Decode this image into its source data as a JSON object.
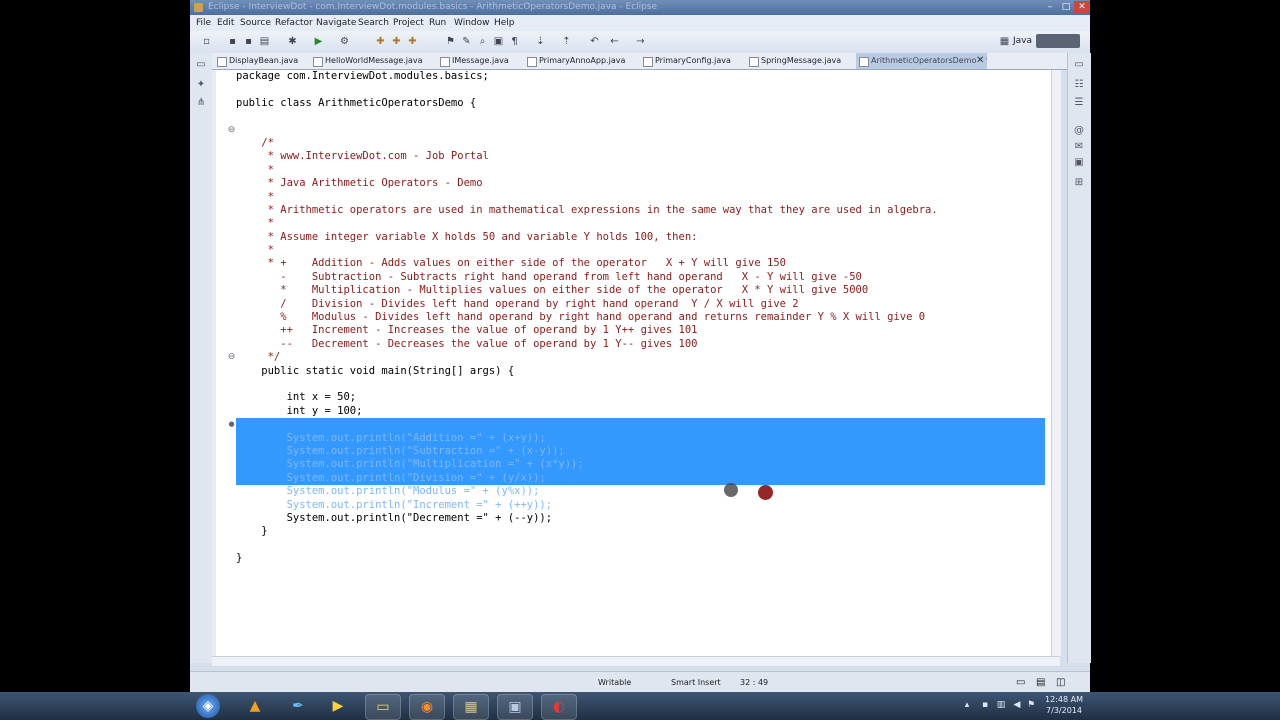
{
  "window": {
    "title": "Eclipse - InterviewDot - com.InterviewDot.modules.basics - ArithmeticOperatorsDemo.java - Eclipse",
    "minimize": "–",
    "maximize": "□",
    "close": "✕"
  },
  "menu": [
    "File",
    "Edit",
    "Source",
    "Refactor",
    "Navigate",
    "Search",
    "Project",
    "Run",
    "Window",
    "Help"
  ],
  "perspective": {
    "label": "Java"
  },
  "tabs": [
    {
      "label": "DisplayBean.java"
    },
    {
      "label": "HelloWorldMessage.java"
    },
    {
      "label": "IMessage.java"
    },
    {
      "label": "PrimaryAnnoApp.java"
    },
    {
      "label": "PrimaryConfig.java"
    },
    {
      "label": "SpringMessage.java"
    },
    {
      "label": "ArithmeticOperatorsDemo.java",
      "active": true,
      "close": "✕"
    }
  ],
  "code": {
    "lines": [
      "package com.InterviewDot.modules.basics;",
      "",
      "public class ArithmeticOperatorsDemo {",
      "",
      "",
      "    /*",
      "     * www.InterviewDot.com - Job Portal",
      "     *",
      "     * Java Arithmetic Operators - Demo",
      "     *",
      "     * Arithmetic operators are used in mathematical expressions in the same way that they are used in algebra.",
      "     *",
      "     * Assume integer variable X holds 50 and variable Y holds 100, then:",
      "     *",
      "     * +    Addition - Adds values on either side of the operator   X + Y will give 150",
      "       -    Subtraction - Subtracts right hand operand from left hand operand   X - Y will give -50",
      "       *    Multiplication - Multiplies values on either side of the operator   X * Y will give 5000",
      "       /    Division - Divides left hand operand by right hand operand  Y / X will give 2",
      "       %    Modulus - Divides left hand operand by right hand operand and returns remainder Y % X will give 0",
      "       ++   Increment - Increases the value of operand by 1 Y++ gives 101",
      "       --   Decrement - Decreases the value of operand by 1 Y-- gives 100",
      "     */",
      "    public static void main(String[] args) {",
      "",
      "        int x = 50;",
      "        int y = 100;",
      "",
      "        System.out.println(\"Addition =\" + (x+y));",
      "        System.out.println(\"Subtraction =\" + (x-y));",
      "        System.out.println(\"Multiplication =\" + (x*y));",
      "        System.out.println(\"Division =\" + (y/x));",
      "        System.out.println(\"Modulus =\" + (y%x));",
      "        System.out.println(\"Increment =\" + (++y));",
      "        System.out.println(\"Decrement =\" + (--y));",
      "    }",
      "",
      "}"
    ]
  },
  "status": {
    "writable": "Writable",
    "insert_mode": "Smart Insert",
    "position": "32 : 49"
  },
  "taskbar": {
    "time": "12:48 AM",
    "date": "7/3/2014"
  },
  "colors": {
    "selection": "#3399ff",
    "comment": "#8b1a1a",
    "title_bar": "#4d6f9e"
  }
}
